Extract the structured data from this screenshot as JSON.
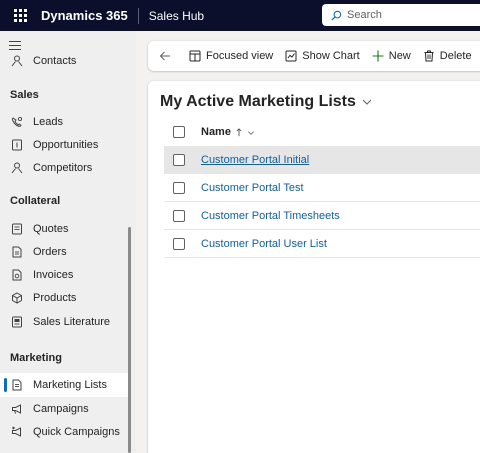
{
  "topbar": {
    "app_name": "Dynamics 365",
    "hub_name": "Sales Hub",
    "search_placeholder": "Search"
  },
  "sidebar": {
    "partial_item": "Contacts",
    "sections": [
      {
        "title": "Sales",
        "items": [
          "Leads",
          "Opportunities",
          "Competitors"
        ]
      },
      {
        "title": "Collateral",
        "items": [
          "Quotes",
          "Orders",
          "Invoices",
          "Products",
          "Sales Literature"
        ]
      },
      {
        "title": "Marketing",
        "items": [
          "Marketing Lists",
          "Campaigns",
          "Quick Campaigns"
        ]
      }
    ],
    "selected_item": "Marketing Lists"
  },
  "commandbar": {
    "focused_view": "Focused view",
    "show_chart": "Show Chart",
    "new": "New",
    "delete": "Delete"
  },
  "grid": {
    "view_title": "My Active Marketing Lists",
    "column_name": "Name",
    "rows": [
      "Customer Portal Initial",
      "Customer Portal Test",
      "Customer Portal Timesheets",
      "Customer Portal User List"
    ]
  },
  "colors": {
    "topbar_bg": "#0b0f2b",
    "accent": "#0f6cbd",
    "link": "#115ea3"
  }
}
